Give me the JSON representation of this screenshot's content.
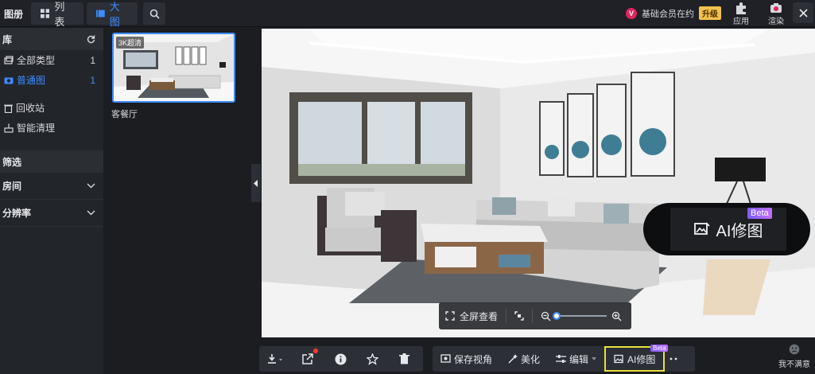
{
  "topbar": {
    "app_title": "图册",
    "view_list": "列表",
    "view_big": "大图",
    "member_text": "基础会员在约",
    "member_vip": "V",
    "upgrade": "升级",
    "apps_label": "应用",
    "render_label": "渲染"
  },
  "sidebar": {
    "library": "库",
    "items": [
      {
        "label": "全部类型",
        "count": "1"
      },
      {
        "label": "普通图",
        "count": "1"
      }
    ],
    "recycle": "回收站",
    "smart_clean": "智能清理",
    "filter": "筛选",
    "room": "房间",
    "resolution": "分辨率"
  },
  "thumbs": [
    {
      "badge": "3K超清",
      "label": "客餐厅"
    }
  ],
  "viewer": {
    "fullscreen": "全屏查看",
    "zoom_level": 0,
    "ai_label": "AI修图",
    "beta": "Beta"
  },
  "toolbar": {
    "save_view": "保存视角",
    "beautify": "美化",
    "edit": "编辑",
    "ai_retouch": "AI修图",
    "beta": "Beta",
    "unsatisfied": "我不满意"
  },
  "colors": {
    "accent": "#3d8cff",
    "highlight": "#e8e03a",
    "upgrade": "#f2c14e"
  }
}
